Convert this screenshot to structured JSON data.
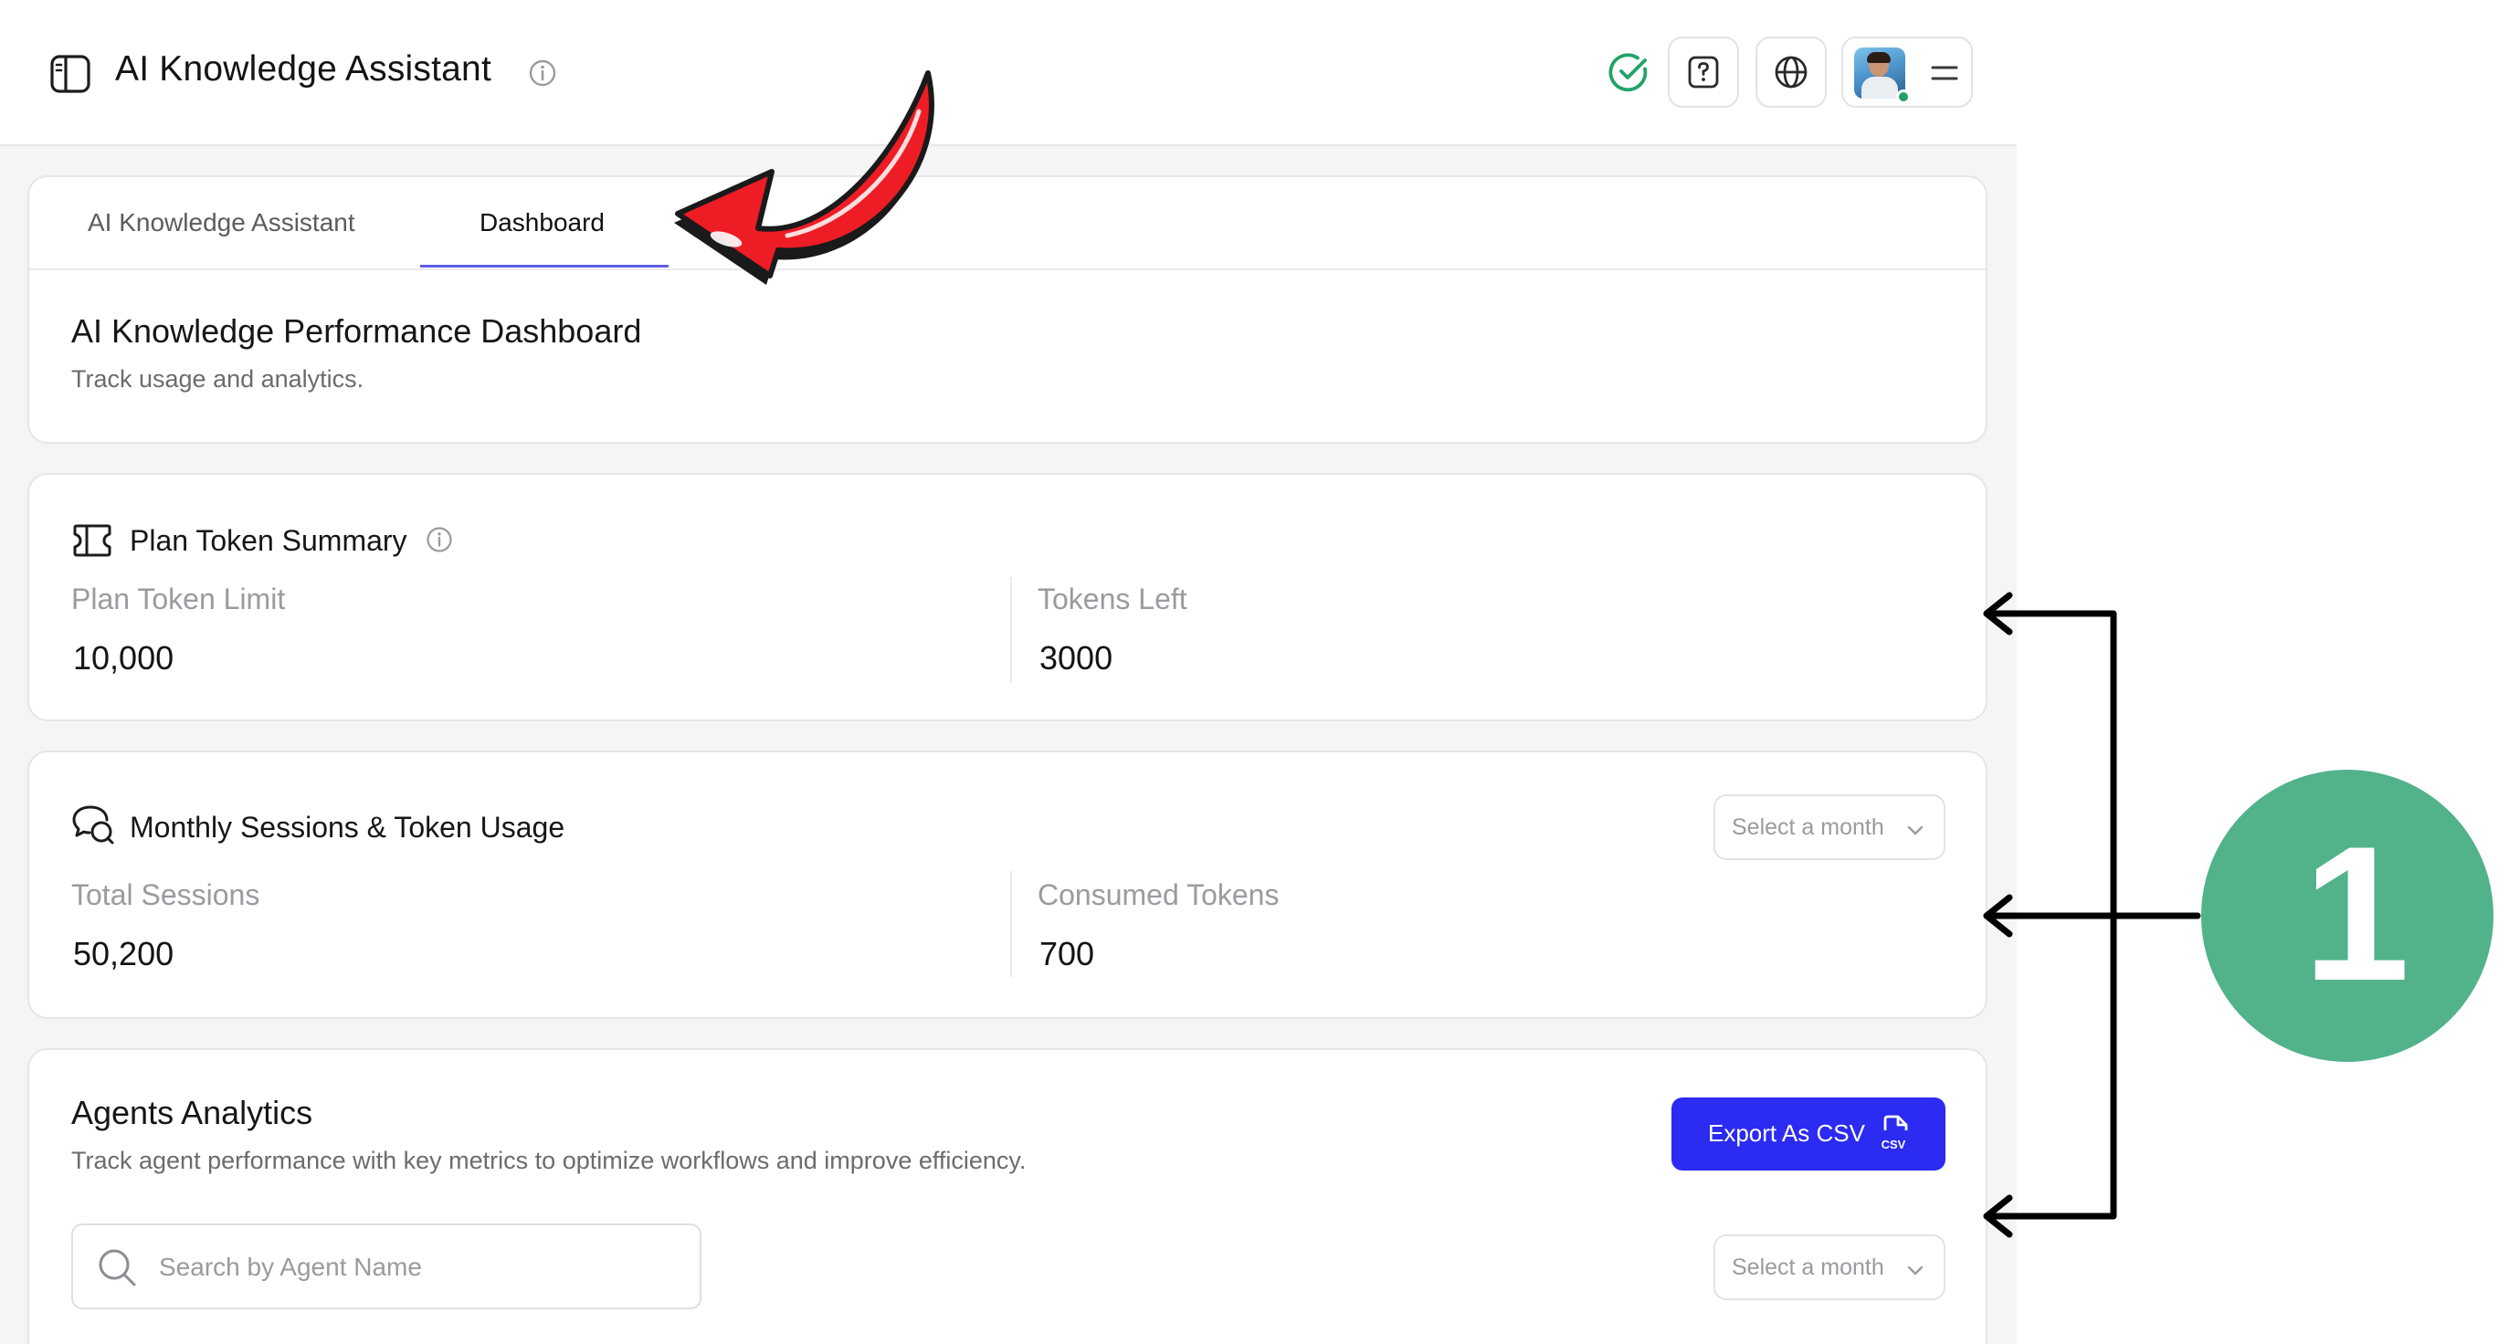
{
  "header": {
    "title": "AI Knowledge Assistant",
    "icons": [
      "sidebar-icon",
      "info-icon",
      "check-circle-icon",
      "help-icon",
      "globe-icon",
      "menu-icon"
    ],
    "status_color": "#21a366"
  },
  "tabs": [
    {
      "label": "AI Knowledge Assistant",
      "active": false
    },
    {
      "label": "Dashboard",
      "active": true
    }
  ],
  "dashboard": {
    "title": "AI Knowledge Performance Dashboard",
    "subtitle": "Track usage and analytics."
  },
  "plan_token_summary": {
    "title": "Plan Token Summary",
    "limit_label": "Plan Token Limit",
    "limit_value": "10,000",
    "left_label": "Tokens Left",
    "left_value": "3000"
  },
  "monthly_usage": {
    "title": "Monthly Sessions & Token Usage",
    "month_placeholder": "Select a month",
    "sessions_label": "Total Sessions",
    "sessions_value": "50,200",
    "consumed_label": "Consumed Tokens",
    "consumed_value": "700"
  },
  "agents_analytics": {
    "title": "Agents Analytics",
    "subtitle": "Track agent performance with key metrics to optimize workflows and improve efficiency.",
    "export_label": "Export As CSV",
    "search_placeholder": "Search by Agent Name",
    "month_placeholder": "Select a month"
  },
  "annotation": {
    "number": "1",
    "circle_color": "#52b28a",
    "arrow_color": "#ee1c25"
  },
  "colors": {
    "accent": "#2b2bf2",
    "tab_underline": "#5d5fe0"
  }
}
